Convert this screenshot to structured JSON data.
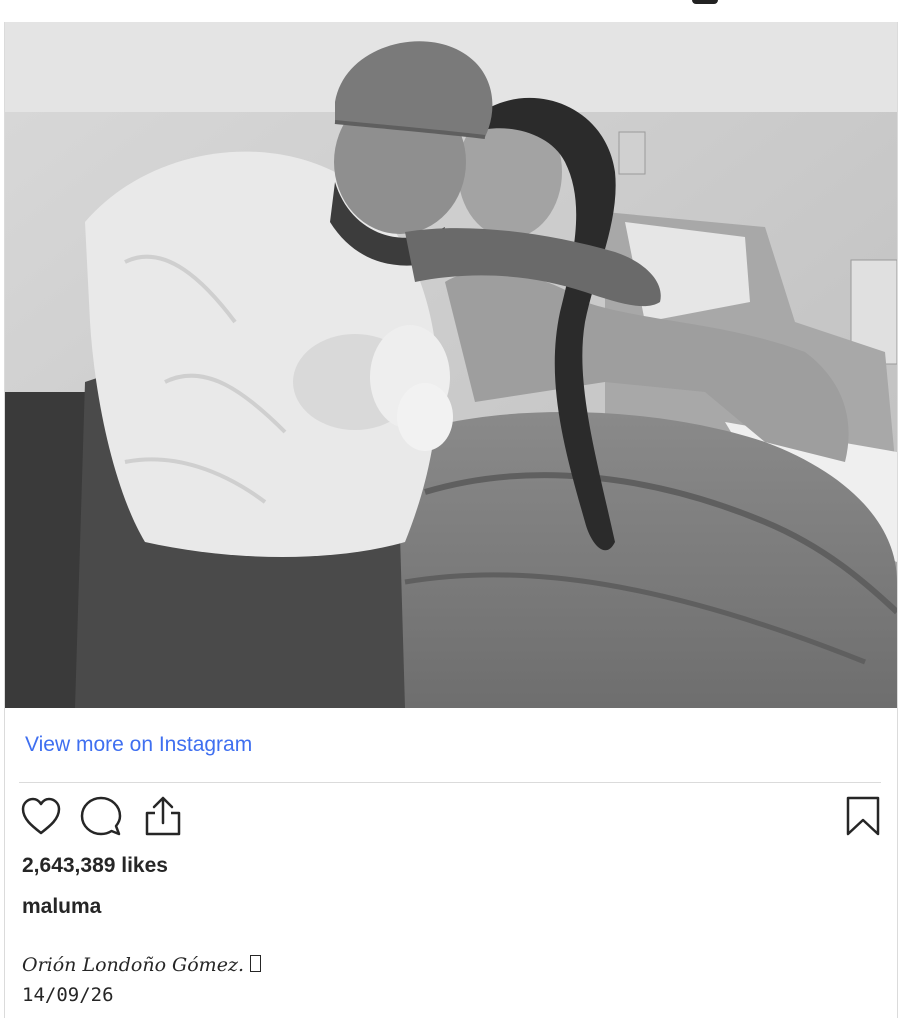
{
  "post": {
    "image_alt": "Black-and-white hospital photo: a man in a cap and robe holding a newborn, touching foreheads with a woman in a hospital bed",
    "view_more_label": "View more on Instagram",
    "likes_text": "2,643,389 likes",
    "username": "maluma",
    "caption": "Orión Londoño Gómez.",
    "date_text": "14/09/26"
  },
  "icons": {
    "like": "heart-icon",
    "comment": "comment-icon",
    "share": "share-icon",
    "save": "bookmark-icon"
  },
  "colors": {
    "link": "#3f6ff0",
    "text": "#262626",
    "divider": "#dbdbdb"
  }
}
